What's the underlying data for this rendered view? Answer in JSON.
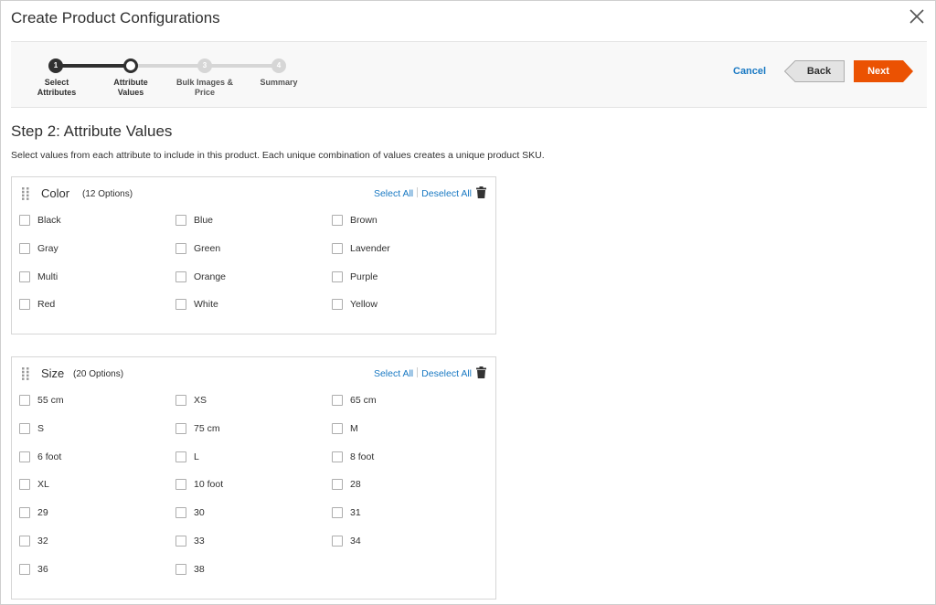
{
  "modal": {
    "title": "Create Product Configurations"
  },
  "steps": [
    {
      "number": "1",
      "label_line1": "Select",
      "label_line2": "Attributes",
      "state": "done"
    },
    {
      "number": "",
      "label_line1": "Attribute",
      "label_line2": "Values",
      "state": "active"
    },
    {
      "number": "3",
      "label_line1": "Bulk Images &",
      "label_line2": "Price",
      "state": "todo"
    },
    {
      "number": "4",
      "label_line1": "Summary",
      "label_line2": "",
      "state": "todo"
    }
  ],
  "actions": {
    "cancel_label": "Cancel",
    "back_label": "Back",
    "next_label": "Next"
  },
  "page": {
    "heading": "Step 2: Attribute Values",
    "description": "Select values from each attribute to include in this product. Each unique combination of values creates a unique product SKU."
  },
  "attributes": [
    {
      "name": "Color",
      "count_label": "(12 Options)",
      "select_all_label": "Select All",
      "deselect_all_label": "Deselect All",
      "options": [
        "Black",
        "Blue",
        "Brown",
        "Gray",
        "Green",
        "Lavender",
        "Multi",
        "Orange",
        "Purple",
        "Red",
        "White",
        "Yellow"
      ]
    },
    {
      "name": "Size",
      "count_label": "(20 Options)",
      "select_all_label": "Select All",
      "deselect_all_label": "Deselect All",
      "options": [
        "55 cm",
        "XS",
        "65 cm",
        "S",
        "75 cm",
        "M",
        "6 foot",
        "L",
        "8 foot",
        "XL",
        "10 foot",
        "28",
        "29",
        "30",
        "31",
        "32",
        "33",
        "34",
        "36",
        "38"
      ]
    }
  ],
  "colors": {
    "accent": "#eb5202",
    "link": "#1979c3",
    "text": "#303030"
  }
}
